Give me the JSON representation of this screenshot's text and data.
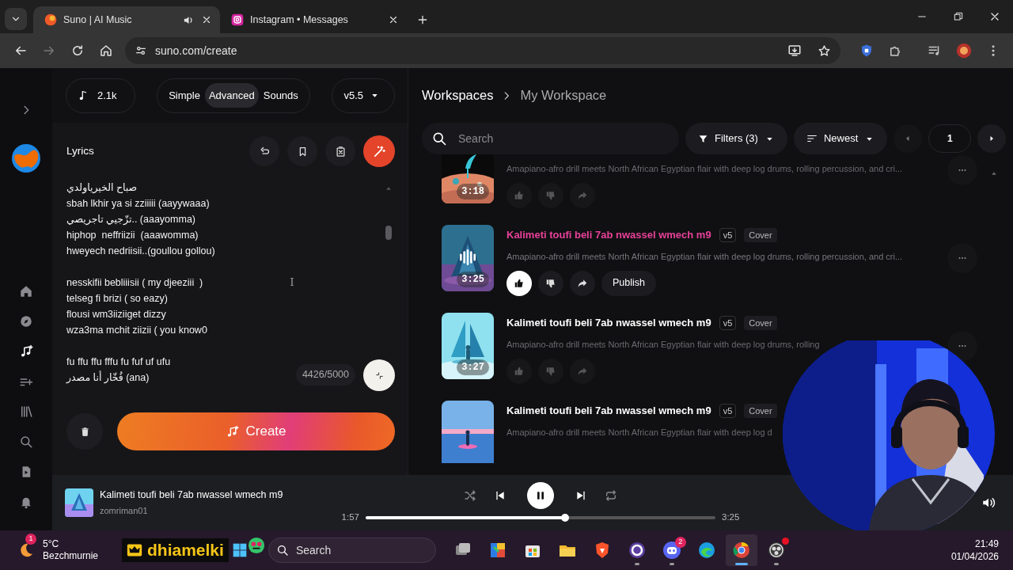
{
  "browser": {
    "tabs": [
      {
        "title": "Suno | AI Music",
        "selected": true,
        "audio": true
      },
      {
        "title": "Instagram • Messages",
        "selected": false,
        "audio": false
      }
    ],
    "address": "suno.com/create"
  },
  "sidebar": {
    "items": [
      {
        "selected": false
      },
      {
        "selected": false
      },
      {
        "selected": true
      },
      {
        "selected": false
      },
      {
        "selected": false
      },
      {
        "selected": false
      },
      {
        "selected": false
      },
      {
        "selected": false
      }
    ]
  },
  "credits": "2.1k",
  "modes": [
    {
      "label": "Simple",
      "selected": false
    },
    {
      "label": "Advanced",
      "selected": true
    },
    {
      "label": "Sounds",
      "selected": false
    }
  ],
  "model": "v5.5",
  "lyrics": {
    "label": "Lyrics",
    "stanzas": [
      [
        "صباح الخيرياولدي",
        "sbah lkhir ya si zziiiii (aayywaaa)",
        "تزّجيي تاجريصي.. (aaayomma)",
        "hiphop  neffriizii  (aaawomma)",
        "hweyech nedriisii..(goullou gollou)"
      ],
      [
        "nesskifii bebliiisii ( my djeeziii  )",
        "telseg fi brizi ( so eazy)",
        "flousi wm3iiziiget dizzy",
        "wza3ma mchit ziizii ( you know0"
      ],
      [
        "fu ffu ffu fffu fu fuf uf ufu",
        "فُخّار أنا مصدر (ana)"
      ]
    ],
    "counter": "4426/5000"
  },
  "create_label": "Create",
  "workspace": {
    "breadcrumb": [
      "Workspaces",
      "My Workspace"
    ],
    "search_placeholder": "Search",
    "filters": "Filters (3)",
    "sort": "Newest",
    "page": "1"
  },
  "songs": [
    {
      "description": "Amapiano-afro drill meets North African Egyptian flair with deep log drums, rolling percussion, and cri...",
      "duration": "3:18",
      "selected": false,
      "liked": false,
      "more_button": true
    },
    {
      "title": "Kalimeti toufi beli 7ab nwassel wmech m9",
      "version": "v5",
      "tag": "Cover",
      "description": "Amapiano-afro drill meets North African Egyptian flair with deep log drums, rolling percussion, and cri...",
      "duration": "3:25",
      "selected": true,
      "liked": true,
      "publish": "Publish",
      "more_button": true
    },
    {
      "title": "Kalimeti toufi beli 7ab nwassel wmech m9",
      "version": "v5",
      "tag": "Cover",
      "description": "Amapiano-afro drill meets North African Egyptian flair with deep log drums, rolling",
      "duration": "3:27",
      "selected": false,
      "liked": false,
      "more_button": true
    },
    {
      "title": "Kalimeti toufi beli 7ab nwassel wmech m9",
      "version": "v5",
      "tag": "Cover",
      "description": "Amapiano-afro drill meets North African Egyptian flair with deep log d",
      "selected": false
    }
  ],
  "player": {
    "title": "Kalimeti toufi beli 7ab nwassel wmech m9",
    "artist": "zomriman01",
    "elapsed": "1:57",
    "duration": "3:25",
    "level": 0.57,
    "playing": true
  },
  "taskbar": {
    "temperature": "5°C",
    "weather": "Bezchmurnie",
    "weather_badge": "1",
    "overlay": "dhiamelki",
    "search_placeholder": "Search",
    "apps": [
      {
        "running": false,
        "active": false
      },
      {
        "running": false,
        "active": false
      },
      {
        "running": false,
        "active": false
      },
      {
        "running": false,
        "active": false
      },
      {
        "running": false,
        "active": false
      },
      {
        "running": true,
        "active": false
      },
      {
        "running": true,
        "active": false,
        "badge": "2"
      },
      {
        "running": false,
        "active": false
      },
      {
        "running": true,
        "active": true
      },
      {
        "running": true,
        "active": false,
        "alert": true
      }
    ],
    "time": "21:49",
    "date": "01/04/2026"
  }
}
